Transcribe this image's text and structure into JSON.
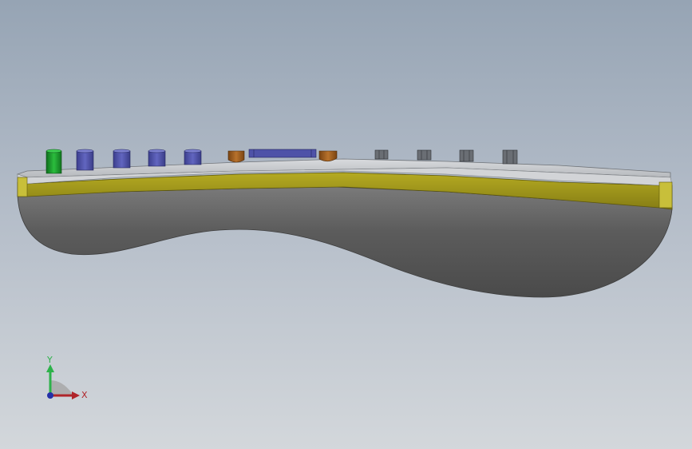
{
  "viewport": {
    "background_top": "#96a4b4",
    "background_bottom": "#d3d7db"
  },
  "model": {
    "body_color": "#5f5f5f",
    "stripe_color": "#a39a1c",
    "top_face_color": "#c8cbcf",
    "components": [
      {
        "name": "green-cylinder",
        "color": "#1e9a2e"
      },
      {
        "name": "blue-cylinder",
        "color": "#4e52a8"
      },
      {
        "name": "orange-cylinder",
        "color": "#9a5a1c"
      },
      {
        "name": "gray-connector",
        "color": "#6a6e74"
      }
    ]
  },
  "triad": {
    "x_label": "X",
    "y_label": "Y",
    "x_color": "#b0252a",
    "y_color": "#2db24a",
    "z_color": "#2430a8"
  }
}
